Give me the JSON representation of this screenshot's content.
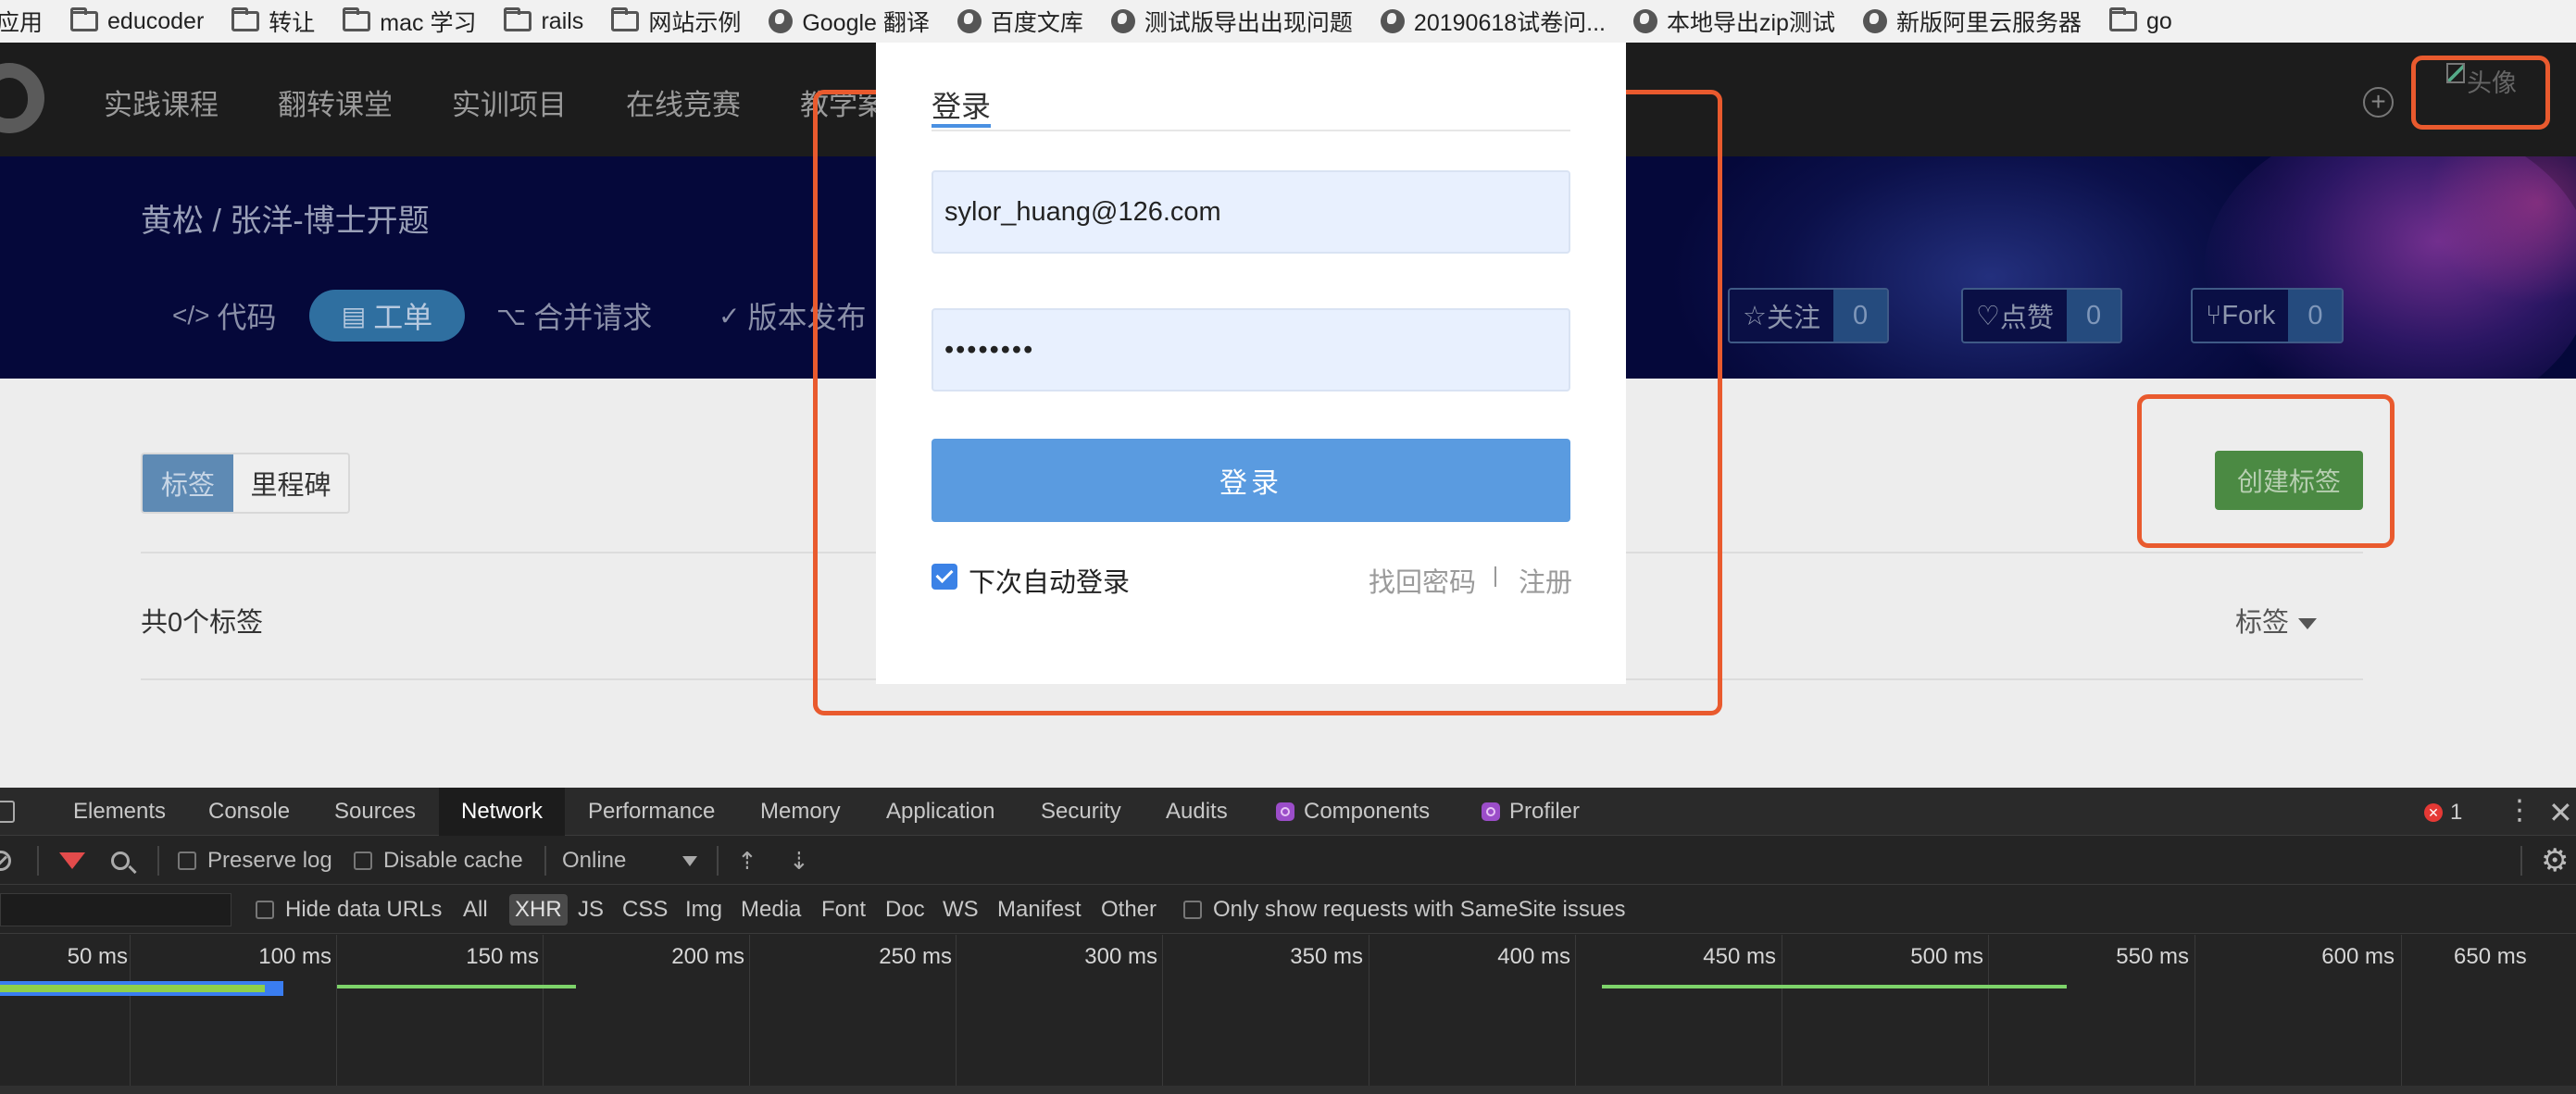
{
  "bookmarks": [
    {
      "label": "应用",
      "icon": "none"
    },
    {
      "label": "educoder",
      "icon": "folder-icon"
    },
    {
      "label": "转让",
      "icon": "folder-icon"
    },
    {
      "label": "mac 学习",
      "icon": "folder-icon"
    },
    {
      "label": "rails",
      "icon": "folder-icon"
    },
    {
      "label": "网站示例",
      "icon": "folder-icon"
    },
    {
      "label": "Google 翻译",
      "icon": "globe-icon"
    },
    {
      "label": "百度文库",
      "icon": "globe-icon"
    },
    {
      "label": "测试版导出出现问题",
      "icon": "globe-icon"
    },
    {
      "label": "20190618试卷问...",
      "icon": "globe-icon"
    },
    {
      "label": "本地导出zip测试",
      "icon": "globe-icon"
    },
    {
      "label": "新版阿里云服务器",
      "icon": "globe-icon"
    },
    {
      "label": "go",
      "icon": "folder-icon"
    }
  ],
  "nav": {
    "items": [
      "实践课程",
      "翻转课堂",
      "实训项目",
      "在线竞赛",
      "教学案"
    ],
    "avatar_alt": "头像",
    "plus_icon": "plus-circle-icon"
  },
  "project": {
    "title": "黄松 / 张洋-博士开题",
    "tabs": [
      {
        "label": "代码",
        "icon": "</>"
      },
      {
        "label": "工单",
        "icon": "▤"
      },
      {
        "label": "合并请求",
        "icon": "⌥"
      },
      {
        "label": "版本发布",
        "icon": "✓"
      }
    ],
    "watch": {
      "label": "关注",
      "count": "0"
    },
    "like": {
      "label": "点赞",
      "count": "0"
    },
    "fork": {
      "label": "Fork",
      "count": "0"
    }
  },
  "labels_page": {
    "seg_tags": "标签",
    "seg_milestones": "里程碑",
    "create_button": "创建标签",
    "count_text": "共0个标签",
    "sort_label": "标签"
  },
  "login_modal": {
    "tab_label": "登录",
    "email_value": "sylor_huang@126.com",
    "password_value": "••••••••",
    "login_button": "登录",
    "remember_label": "下次自动登录",
    "forgot_link": "找回密码",
    "register_link": "注册"
  },
  "devtools": {
    "tabs": [
      "Elements",
      "Console",
      "Sources",
      "Network",
      "Performance",
      "Memory",
      "Application",
      "Security",
      "Audits",
      "Components",
      "Profiler"
    ],
    "active_tab": "Network",
    "error_count": "1",
    "toolbar": {
      "preserve_log": "Preserve log",
      "disable_cache": "Disable cache",
      "throttle": "Online"
    },
    "filters": {
      "hide_data_urls": "Hide data URLs",
      "types": [
        "All",
        "XHR",
        "JS",
        "CSS",
        "Img",
        "Media",
        "Font",
        "Doc",
        "WS",
        "Manifest",
        "Other"
      ],
      "active_type": "XHR",
      "samesite": "Only show requests with SameSite issues"
    },
    "timeline_ticks": [
      "50 ms",
      "100 ms",
      "150 ms",
      "200 ms",
      "250 ms",
      "300 ms",
      "350 ms",
      "400 ms",
      "450 ms",
      "500 ms",
      "550 ms",
      "600 ms",
      "650 ms"
    ]
  },
  "colors": {
    "annotation": "#e95a2e",
    "login_button": "#5a9be0",
    "create_button": "#4b8a43",
    "banner": "#05083a"
  }
}
